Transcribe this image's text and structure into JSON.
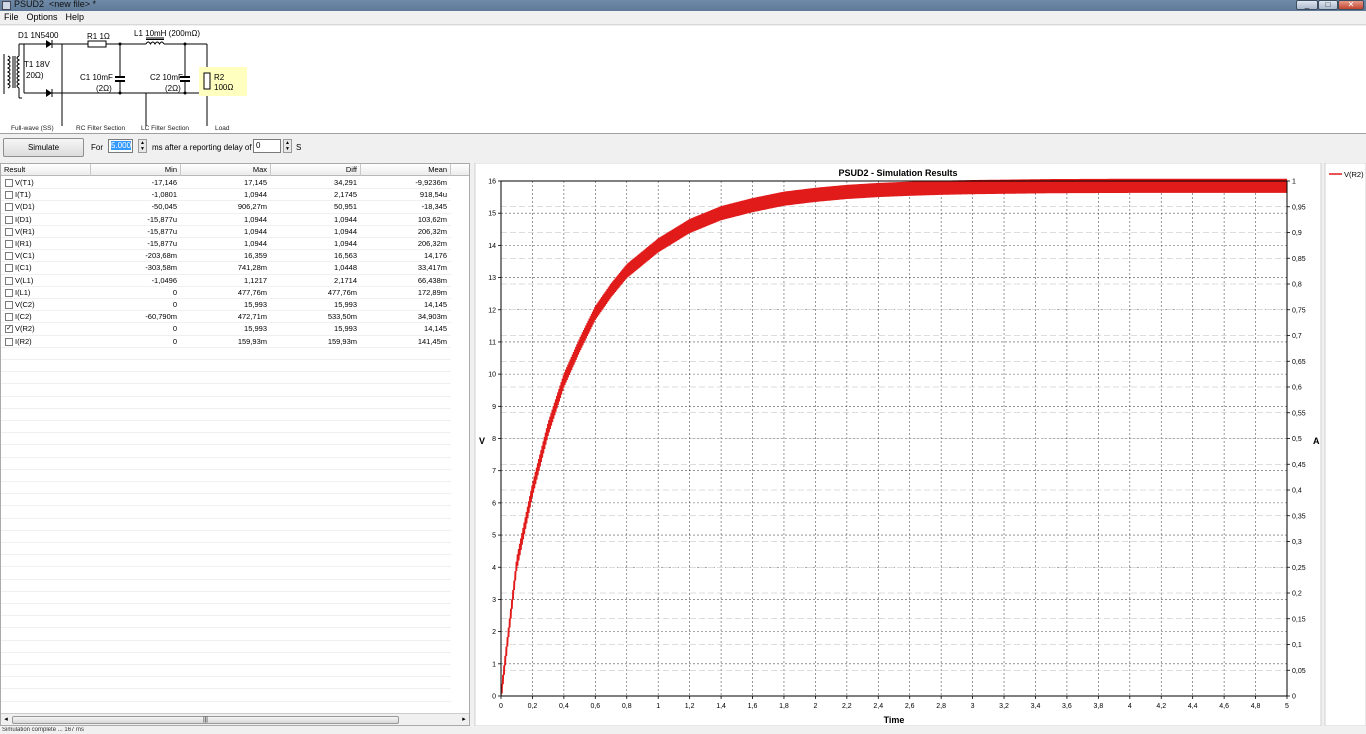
{
  "window": {
    "title": "PSUD2  <new file> *"
  },
  "menu": [
    "File",
    "Options",
    "Help"
  ],
  "schematic": {
    "labels": {
      "d1": "D1 1N5400",
      "r1": "R1 1Ω",
      "l1": "L1 10mH (200mΩ)",
      "t1_line1": "T1 18V",
      "t1_line2": "20Ω)",
      "c1_line1": "C1 10mF",
      "c1_line2": "(2Ω)",
      "c2_line1": "C2 10mF",
      "c2_line2": "(2Ω)",
      "r2_line1": "R2",
      "r2_line2": "100Ω"
    },
    "sections": [
      "Full-wave (SS)",
      "RC Filter Section",
      "LC Filter Section",
      "Load"
    ]
  },
  "toolbar": {
    "simulate_label": "Simulate",
    "for_label": "For",
    "duration_value": "5.000",
    "ms_label": "ms  after a reporting delay of",
    "delay_value": "0",
    "s_label": "S"
  },
  "table": {
    "columns": [
      "Result",
      "Min",
      "Max",
      "Diff",
      "Mean"
    ],
    "rows": [
      {
        "name": "V(T1)",
        "min": "-17,146",
        "max": "17,145",
        "diff": "34,291",
        "mean": "-9,9236m",
        "checked": false
      },
      {
        "name": "I(T1)",
        "min": "-1,0801",
        "max": "1,0944",
        "diff": "2,1745",
        "mean": "918,54u",
        "checked": false
      },
      {
        "name": "V(D1)",
        "min": "-50,045",
        "max": "906,27m",
        "diff": "50,951",
        "mean": "-18,345",
        "checked": false
      },
      {
        "name": "I(D1)",
        "min": "-15,877u",
        "max": "1,0944",
        "diff": "1,0944",
        "mean": "103,62m",
        "checked": false
      },
      {
        "name": "V(R1)",
        "min": "-15,877u",
        "max": "1,0944",
        "diff": "1,0944",
        "mean": "206,32m",
        "checked": false
      },
      {
        "name": "I(R1)",
        "min": "-15,877u",
        "max": "1,0944",
        "diff": "1,0944",
        "mean": "206,32m",
        "checked": false
      },
      {
        "name": "V(C1)",
        "min": "-203,68m",
        "max": "16,359",
        "diff": "16,563",
        "mean": "14,176",
        "checked": false
      },
      {
        "name": "I(C1)",
        "min": "-303,58m",
        "max": "741,28m",
        "diff": "1,0448",
        "mean": "33,417m",
        "checked": false
      },
      {
        "name": "V(L1)",
        "min": "-1,0496",
        "max": "1,1217",
        "diff": "2,1714",
        "mean": "66,438m",
        "checked": false
      },
      {
        "name": "I(L1)",
        "min": "0",
        "max": "477,76m",
        "diff": "477,76m",
        "mean": "172,89m",
        "checked": false
      },
      {
        "name": "V(C2)",
        "min": "0",
        "max": "15,993",
        "diff": "15,993",
        "mean": "14,145",
        "checked": false
      },
      {
        "name": "I(C2)",
        "min": "-60,790m",
        "max": "472,71m",
        "diff": "533,50m",
        "mean": "34,903m",
        "checked": false
      },
      {
        "name": "V(R2)",
        "min": "0",
        "max": "15,993",
        "diff": "15,993",
        "mean": "14,145",
        "checked": true
      },
      {
        "name": "I(R2)",
        "min": "0",
        "max": "159,93m",
        "diff": "159,93m",
        "mean": "141,45m",
        "checked": false
      }
    ]
  },
  "scrollbar": {
    "thumb_grip": "|||"
  },
  "status": {
    "text": "Simulation complete ... 167 ms"
  },
  "colors": {
    "series": "#e11a1a",
    "grid": "#444444",
    "highlight": "#ffffc0",
    "selection": "#3399ff"
  },
  "chart_data": {
    "type": "line",
    "title": "PSUD2 - Simulation Results",
    "xlabel": "Time",
    "ylabel": "V",
    "y2label": "A",
    "xlim": [
      0,
      5
    ],
    "ylim": [
      0,
      16
    ],
    "y2lim": [
      0,
      1
    ],
    "xticks": [
      "0",
      "0,2",
      "0,4",
      "0,6",
      "0,8",
      "1",
      "1,2",
      "1,4",
      "1,6",
      "1,8",
      "2",
      "2,2",
      "2,4",
      "2,6",
      "2,8",
      "3",
      "3,2",
      "3,4",
      "3,6",
      "3,8",
      "4",
      "4,2",
      "4,4",
      "4,6",
      "4,8",
      "5"
    ],
    "yticks": [
      "0",
      "1",
      "2",
      "3",
      "4",
      "5",
      "6",
      "7",
      "8",
      "9",
      "10",
      "11",
      "12",
      "13",
      "14",
      "15",
      "16"
    ],
    "y2ticks": [
      "0",
      "0,05",
      "0,1",
      "0,15",
      "0,2",
      "0,25",
      "0,3",
      "0,35",
      "0,4",
      "0,45",
      "0,5",
      "0,55",
      "0,6",
      "0,65",
      "0,7",
      "0,75",
      "0,8",
      "0,85",
      "0,9",
      "0,95",
      "1"
    ],
    "legend": {
      "position": "right",
      "entries": [
        "V(R2)"
      ]
    },
    "grid": true,
    "series": [
      {
        "name": "V(R2)",
        "x": [
          0,
          0.1,
          0.2,
          0.3,
          0.4,
          0.5,
          0.6,
          0.7,
          0.8,
          0.9,
          1.0,
          1.2,
          1.4,
          1.6,
          1.8,
          2.0,
          2.2,
          2.4,
          2.6,
          2.8,
          3.0,
          3.5,
          4.0,
          4.5,
          5.0
        ],
        "values": [
          0,
          4.1,
          6.4,
          8.3,
          9.8,
          10.9,
          11.9,
          12.6,
          13.2,
          13.6,
          14.0,
          14.6,
          15.0,
          15.25,
          15.45,
          15.57,
          15.66,
          15.72,
          15.76,
          15.79,
          15.81,
          15.84,
          15.85,
          15.85,
          15.85
        ],
        "ripple": 0.22
      }
    ]
  }
}
